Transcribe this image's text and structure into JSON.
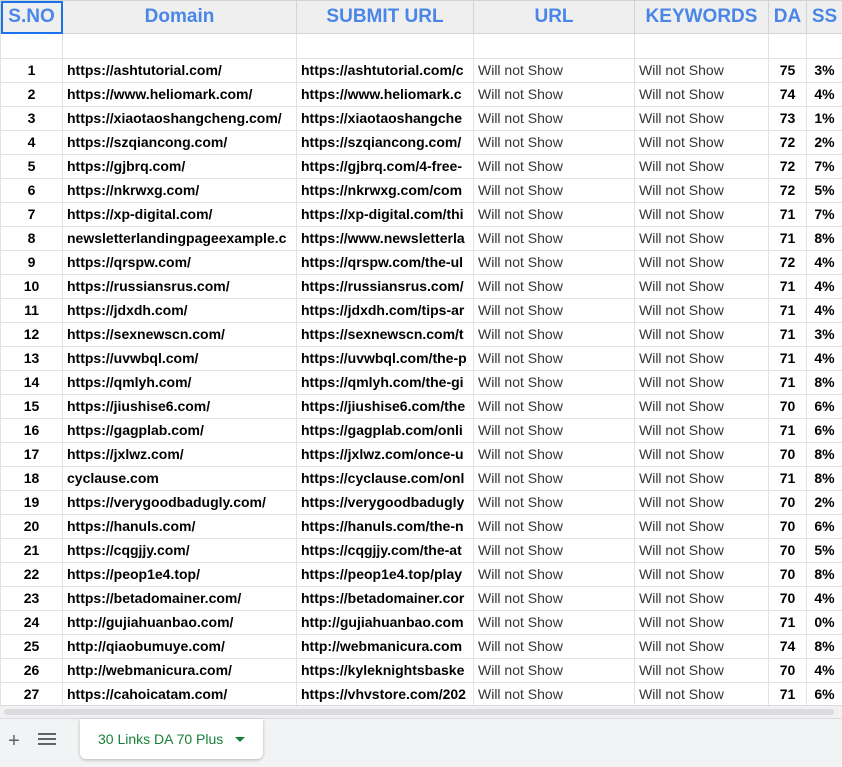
{
  "headers": [
    "S.NO",
    "Domain",
    "SUBMIT URL",
    "URL",
    "KEYWORDS",
    "DA",
    "SS"
  ],
  "rows": [
    {
      "n": "1",
      "domain": "https://ashtutorial.com/",
      "submit": "https://ashtutorial.com/c",
      "url": "Will not Show",
      "kw": "Will not Show",
      "da": "75",
      "ss": "3%"
    },
    {
      "n": "2",
      "domain": "https://www.heliomark.com/",
      "submit": "https://www.heliomark.c",
      "url": "Will not Show",
      "kw": "Will not Show",
      "da": "74",
      "ss": "4%"
    },
    {
      "n": "3",
      "domain": "https://xiaotaoshangcheng.com/",
      "submit": "https://xiaotaoshangche",
      "url": "Will not Show",
      "kw": "Will not Show",
      "da": "73",
      "ss": "1%"
    },
    {
      "n": "4",
      "domain": "https://szqiancong.com/",
      "submit": "https://szqiancong.com/",
      "url": "Will not Show",
      "kw": "Will not Show",
      "da": "72",
      "ss": "2%"
    },
    {
      "n": "5",
      "domain": "https://gjbrq.com/",
      "submit": "https://gjbrq.com/4-free-",
      "url": "Will not Show",
      "kw": "Will not Show",
      "da": "72",
      "ss": "7%"
    },
    {
      "n": "6",
      "domain": "https://nkrwxg.com/",
      "submit": "https://nkrwxg.com/com",
      "url": "Will not Show",
      "kw": "Will not Show",
      "da": "72",
      "ss": "5%"
    },
    {
      "n": "7",
      "domain": "https://xp-digital.com/",
      "submit": "https://xp-digital.com/thi",
      "url": "Will not Show",
      "kw": "Will not Show",
      "da": "71",
      "ss": "7%"
    },
    {
      "n": "8",
      "domain": "newsletterlandingpageexample.c",
      "submit": "https://www.newsletterla",
      "url": "Will not Show",
      "kw": "Will not Show",
      "da": "71",
      "ss": "8%"
    },
    {
      "n": "9",
      "domain": "https://qrspw.com/",
      "submit": "https://qrspw.com/the-ul",
      "url": "Will not Show",
      "kw": "Will not Show",
      "da": "72",
      "ss": "4%"
    },
    {
      "n": "10",
      "domain": "https://russiansrus.com/",
      "submit": "https://russiansrus.com/",
      "url": "Will not Show",
      "kw": "Will not Show",
      "da": "71",
      "ss": "4%"
    },
    {
      "n": "11",
      "domain": "https://jdxdh.com/",
      "submit": "https://jdxdh.com/tips-ar",
      "url": "Will not Show",
      "kw": "Will not Show",
      "da": "71",
      "ss": "4%"
    },
    {
      "n": "12",
      "domain": "https://sexnewscn.com/",
      "submit": "https://sexnewscn.com/t",
      "url": "Will not Show",
      "kw": "Will not Show",
      "da": "71",
      "ss": "3%"
    },
    {
      "n": "13",
      "domain": "https://uvwbql.com/",
      "submit": "https://uvwbql.com/the-p",
      "url": "Will not Show",
      "kw": "Will not Show",
      "da": "71",
      "ss": "4%"
    },
    {
      "n": "14",
      "domain": "https://qmlyh.com/",
      "submit": "https://qmlyh.com/the-gi",
      "url": "Will not Show",
      "kw": "Will not Show",
      "da": "71",
      "ss": "8%"
    },
    {
      "n": "15",
      "domain": "https://jiushise6.com/",
      "submit": "https://jiushise6.com/the",
      "url": "Will not Show",
      "kw": "Will not Show",
      "da": "70",
      "ss": "6%"
    },
    {
      "n": "16",
      "domain": "https://gagplab.com/",
      "submit": "https://gagplab.com/onli",
      "url": "Will not Show",
      "kw": "Will not Show",
      "da": "71",
      "ss": "6%"
    },
    {
      "n": "17",
      "domain": "https://jxlwz.com/",
      "submit": "https://jxlwz.com/once-u",
      "url": "Will not Show",
      "kw": "Will not Show",
      "da": "70",
      "ss": "8%"
    },
    {
      "n": "18",
      "domain": "cyclause.com",
      "submit": "https://cyclause.com/onl",
      "url": "Will not Show",
      "kw": "Will not Show",
      "da": "71",
      "ss": "8%"
    },
    {
      "n": "19",
      "domain": "https://verygoodbadugly.com/",
      "submit": "https://verygoodbadugly",
      "url": "Will not Show",
      "kw": "Will not Show",
      "da": "70",
      "ss": "2%"
    },
    {
      "n": "20",
      "domain": "https://hanuls.com/",
      "submit": "https://hanuls.com/the-n",
      "url": "Will not Show",
      "kw": "Will not Show",
      "da": "70",
      "ss": "6%"
    },
    {
      "n": "21",
      "domain": "https://cqgjjy.com/",
      "submit": "https://cqgjjy.com/the-at",
      "url": "Will not Show",
      "kw": "Will not Show",
      "da": "70",
      "ss": "5%"
    },
    {
      "n": "22",
      "domain": "https://peop1e4.top/",
      "submit": "https://peop1e4.top/play",
      "url": "Will not Show",
      "kw": "Will not Show",
      "da": "70",
      "ss": "8%"
    },
    {
      "n": "23",
      "domain": "https://betadomainer.com/",
      "submit": "https://betadomainer.cor",
      "url": "Will not Show",
      "kw": "Will not Show",
      "da": "70",
      "ss": "4%"
    },
    {
      "n": "24",
      "domain": "http://gujiahuanbao.com/",
      "submit": "http://gujiahuanbao.com",
      "url": "Will not Show",
      "kw": "Will not Show",
      "da": "71",
      "ss": "0%"
    },
    {
      "n": "25",
      "domain": "http://qiaobumuye.com/",
      "submit": "http://webmanicura.com",
      "url": "Will not Show",
      "kw": "Will not Show",
      "da": "74",
      "ss": "8%"
    },
    {
      "n": "26",
      "domain": "http://webmanicura.com/",
      "submit": "https://kyleknightsbaske",
      "url": "Will not Show",
      "kw": "Will not Show",
      "da": "70",
      "ss": "4%"
    },
    {
      "n": "27",
      "domain": "https://cahoicatam.com/",
      "submit": "https://vhvstore.com/202",
      "url": "Will not Show",
      "kw": "Will not Show",
      "da": "71",
      "ss": "6%"
    }
  ],
  "sheet_tab": {
    "label": "30 Links DA 70 Plus"
  },
  "colors": {
    "header_text": "#4a86e8",
    "tab_text": "#188038",
    "selection": "#1a73e8"
  }
}
